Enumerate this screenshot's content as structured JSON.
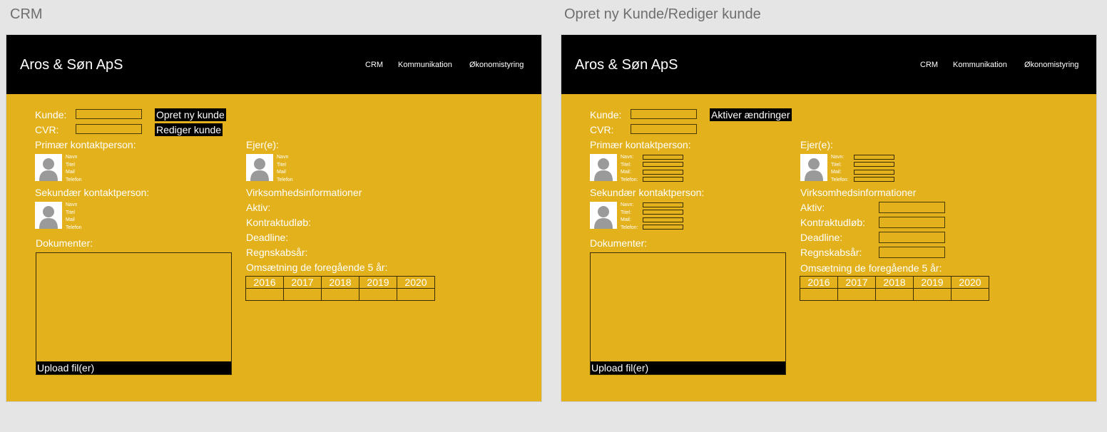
{
  "frames": [
    {
      "frame_title": "CRM",
      "brand": "Aros & Søn ApS",
      "nav": [
        "CRM",
        "Kommunikation",
        "Økonomistyring"
      ],
      "kunde_label": "Kunde:",
      "cvr_label": "CVR:",
      "buttons": {
        "primary": "Opret ny kunde",
        "secondary": "Rediger kunde"
      },
      "primary_contact_label": "Primær kontaktperson:",
      "secondary_contact_label": "Sekundær kontaktperson:",
      "owner_label": "Ejer(e):",
      "contact_fields": [
        "Navn",
        "Titel",
        "Mail",
        "Telefon"
      ],
      "company_info_label": "Virksomhedsinformationer",
      "info_fields": [
        "Aktiv:",
        "Kontraktudløb:",
        "Deadline:",
        "Regnskabsår:"
      ],
      "revenue_label": "Omsætning de foregående 5 år:",
      "years": [
        "2016",
        "2017",
        "2018",
        "2019",
        "2020"
      ],
      "documents_label": "Dokumenter:",
      "upload_label": "Upload fil(er)"
    },
    {
      "frame_title": "Opret ny Kunde/Rediger kunde",
      "brand": "Aros & Søn ApS",
      "nav": [
        "CRM",
        "Kommunikation",
        "Økonomistyring"
      ],
      "kunde_label": "Kunde:",
      "cvr_label": "CVR:",
      "buttons": {
        "primary": "Aktiver ændringer"
      },
      "primary_contact_label": "Primær kontaktperson:",
      "secondary_contact_label": "Sekundær kontaktperson:",
      "owner_label": "Ejer(e):",
      "contact_fields": [
        "Navn:",
        "Titel:",
        "Mail:",
        "Telefon:"
      ],
      "company_info_label": "Virksomhedsinformationer",
      "info_fields": [
        "Aktiv:",
        "Kontraktudløb:",
        "Deadline:",
        "Regnskabsår:"
      ],
      "revenue_label": "Omsætning de foregående 5 år:",
      "years": [
        "2016",
        "2017",
        "2018",
        "2019",
        "2020"
      ],
      "documents_label": "Dokumenter:",
      "upload_label": "Upload fil(er)"
    }
  ]
}
